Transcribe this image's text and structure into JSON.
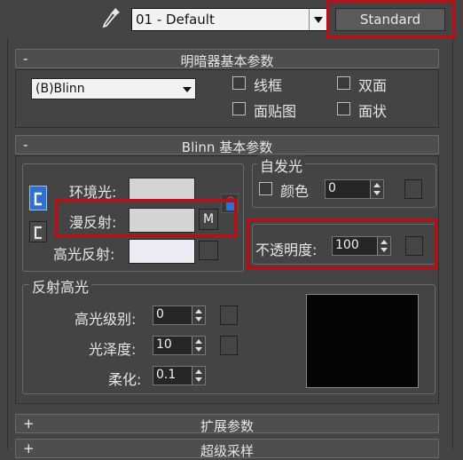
{
  "toolbar": {
    "material_name": "01 - Default",
    "type_button": "Standard"
  },
  "shader_rollout": {
    "collapse_symbol": "-",
    "title": "明暗器基本参数",
    "shader_value": "(B)Blinn",
    "checkboxes": [
      "线框",
      "双面",
      "面贴图",
      "面状"
    ]
  },
  "blinn_rollout": {
    "collapse_symbol": "-",
    "title": "Blinn 基本参数",
    "ambient_label": "环境光:",
    "diffuse_label": "漫反射:",
    "specular_label": "高光反射:",
    "map_button": "M",
    "self_illum": {
      "title": "自发光",
      "color_label": "颜色",
      "value": "0"
    },
    "opacity_label": "不透明度:",
    "opacity_value": "100",
    "spec_highlights": {
      "title": "反射高光",
      "level_label": "高光级别:",
      "level_value": "0",
      "gloss_label": "光泽度:",
      "gloss_value": "10",
      "soften_label": "柔化:",
      "soften_value": "0.1"
    }
  },
  "collapsed_rollouts": [
    {
      "symbol": "+",
      "title": "扩展参数"
    },
    {
      "symbol": "+",
      "title": "超级采样"
    }
  ],
  "colors": {
    "highlight": "#a8161c",
    "background": "#444444",
    "swatch": "#d4d4d4",
    "specular_swatch": "#ececf2"
  }
}
